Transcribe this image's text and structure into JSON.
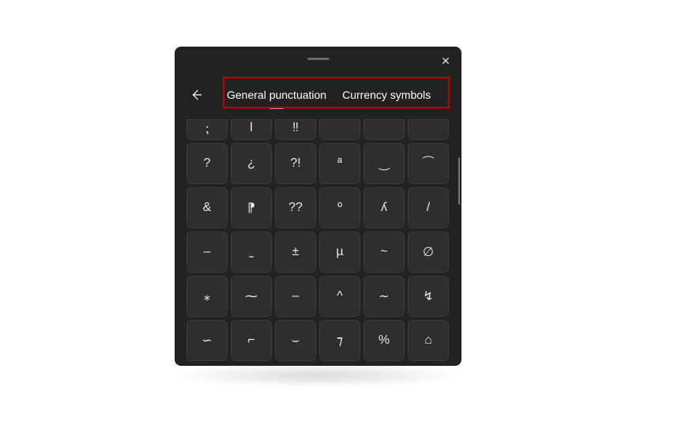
{
  "tabs": {
    "general": "General punctuation",
    "currency": "Currency symbols"
  },
  "row0": [
    "⁏",
    "ǀ",
    "‼",
    "",
    "",
    ""
  ],
  "rows": [
    [
      "?",
      "¿",
      "?!",
      "ª",
      "‿",
      "⁀"
    ],
    [
      "&",
      "⁋",
      "??",
      "º",
      "ʎ",
      "/"
    ],
    [
      "–",
      "˷",
      "±",
      "µ",
      "~",
      "∅"
    ],
    [
      "⁎",
      "⁓",
      "‒",
      "^",
      "∼",
      "↯"
    ],
    [
      "∽",
      "⌐",
      "⌣",
      "⁊",
      "%",
      "⌂"
    ]
  ]
}
